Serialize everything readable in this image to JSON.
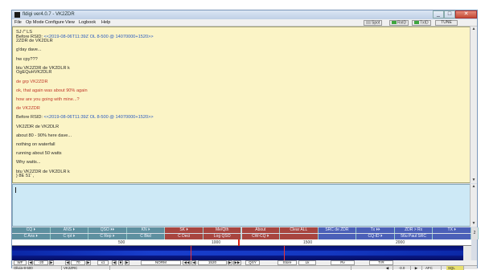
{
  "window": {
    "title": "fldigi ver4.0.7 - VK2ZDR",
    "controls": {
      "minimize": "_",
      "maximize": "□",
      "close": "✕"
    }
  },
  "menubar": {
    "items": [
      "File",
      "Op Mode",
      "Configure",
      "View",
      "Logbook",
      "Help"
    ],
    "status": {
      "spot": "Spot",
      "rxid": "RxID",
      "txid": "TxID",
      "tune": "TUNE"
    }
  },
  "receive_text": [
    {
      "text": "SJ /\" LS",
      "color": "#2a2a2a"
    },
    {
      "text": "Before RSID: <<2019-08-06T11:39Z OL 8-500 @ 14070000+1520>>",
      "color": "#2a2a2a",
      "highlight": "<<2019-08-06T11:39Z OL 8-500 @ 14070000+1520>>"
    },
    {
      "text": "2ZDR de VK2DLR",
      "color": "#2a2a2a"
    },
    {
      "text": "",
      "color": "#2a2a2a"
    },
    {
      "text": "g'day dave...",
      "color": "#2a2a2a"
    },
    {
      "text": "",
      "color": "#2a2a2a"
    },
    {
      "text": "hw cpy???",
      "color": "#2a2a2a"
    },
    {
      "text": "",
      "color": "#2a2a2a"
    },
    {
      "text": " btu  VK2ZDR de VK2DLR k",
      "color": "#2a2a2a"
    },
    {
      "text": "OgEQuHVK2DLR",
      "color": "#2a2a2a"
    },
    {
      "text": "",
      "color": "#2a2a2a"
    },
    {
      "text": "de grp VK2ZDR",
      "color": "#c0392b"
    },
    {
      "text": "",
      "color": "#c0392b"
    },
    {
      "text": "ok, that again was about 90% again",
      "color": "#c0392b"
    },
    {
      "text": "",
      "color": "#c0392b"
    },
    {
      "text": "how are you going with mine...?",
      "color": "#c0392b"
    },
    {
      "text": "",
      "color": "#c0392b"
    },
    {
      "text": "de VK2ZDR",
      "color": "#c0392b"
    },
    {
      "text": "",
      "color": "#2a2a2a"
    },
    {
      "text": "Before RSID: <<2019-08-06T11:39Z OL 8-500 @ 14070000+1520>>",
      "color": "#2a2a2a",
      "highlight": "<<2019-08-06T11:39Z OL 8-500 @ 14070000+1520>>"
    },
    {
      "text": "",
      "color": "#2a2a2a"
    },
    {
      "text": "VK2ZDR de VK2DLR",
      "color": "#2a2a2a"
    },
    {
      "text": "",
      "color": "#2a2a2a"
    },
    {
      "text": "about 80 - 90% here dave...",
      "color": "#2a2a2a"
    },
    {
      "text": "",
      "color": "#2a2a2a"
    },
    {
      "text": "nothing on waterfall",
      "color": "#2a2a2a"
    },
    {
      "text": "",
      "color": "#2a2a2a"
    },
    {
      "text": "running about 50 watts",
      "color": "#2a2a2a"
    },
    {
      "text": "",
      "color": "#2a2a2a"
    },
    {
      "text": "Why watts...",
      "color": "#2a2a2a"
    },
    {
      "text": "",
      "color": "#2a2a2a"
    },
    {
      "text": " btu  VK2ZDR de VK2DLR k",
      "color": "#2a2a2a"
    },
    {
      "text": "} 8E 51' ,",
      "color": "#2a2a2a"
    }
  ],
  "macros_row1": [
    {
      "label": "CQ ⏵",
      "style": "teal"
    },
    {
      "label": "ANS ⏵",
      "style": "teal"
    },
    {
      "label": "QSO ⏵⏵",
      "style": "teal"
    },
    {
      "label": "KN ⏵",
      "style": "teal"
    },
    {
      "label": "SK ⏵",
      "style": "red"
    },
    {
      "label": "Me/Qth",
      "style": "red"
    },
    {
      "label": "About",
      "style": "red"
    },
    {
      "label": "Clear ALL",
      "style": "red"
    },
    {
      "label": "SRC de ZDR",
      "style": "blue"
    },
    {
      "label": "Tx ⏵⏵",
      "style": "blue"
    },
    {
      "label": "ZDR > Rx",
      "style": "blue"
    },
    {
      "label": "TX ⏵",
      "style": "blue"
    }
  ],
  "macros_row2": [
    {
      "label": "C Ans ⏵",
      "style": "teal"
    },
    {
      "label": "C rpt ⏵",
      "style": "teal"
    },
    {
      "label": "C Rep ⏵",
      "style": "teal"
    },
    {
      "label": "C Bkd",
      "style": "teal"
    },
    {
      "label": "C Deci",
      "style": "red"
    },
    {
      "label": "Log QSO",
      "style": "red"
    },
    {
      "label": "CW-CQ ⏵",
      "style": "red"
    },
    {
      "label": "",
      "style": "red"
    },
    {
      "label": "",
      "style": "blue"
    },
    {
      "label": "CQ-ID ⏵",
      "style": "blue"
    },
    {
      "label": "56u Paul SRC",
      "style": "blue"
    },
    {
      "label": "",
      "style": "blue"
    }
  ],
  "macro_page": "2",
  "ruler_ticks": [
    "500",
    "1000",
    "1500",
    "2000"
  ],
  "controls": {
    "wf": "WF",
    "wf_level": "-20",
    "ref": "70",
    "zoom": "x1",
    "mode": "NORM",
    "freq": "1520",
    "qsy": "QSY",
    "store": "Store",
    "lk": "Lk",
    "rv": "Rv",
    "tr": "T/R"
  },
  "status": {
    "mode": "Olivia-8-500",
    "station": "VK2ZRC",
    "snr": "-3.0",
    "afc": "AFC",
    "sql": "SQL"
  }
}
